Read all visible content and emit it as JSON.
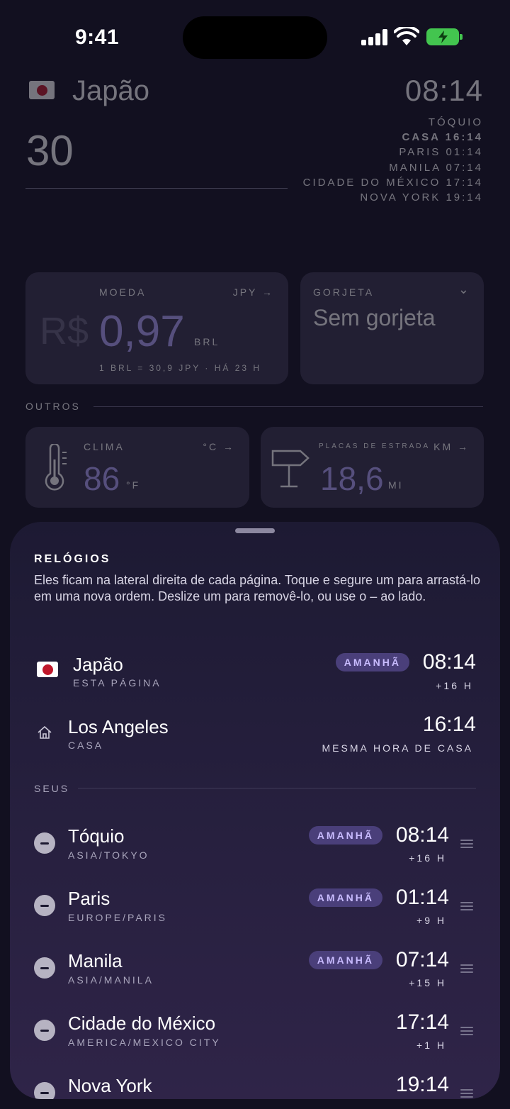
{
  "status_bar": {
    "time": "9:41"
  },
  "header": {
    "country": "Japão",
    "amount": "30",
    "main_clock": "08:14",
    "clocks": [
      {
        "text": "TÓQUIO"
      },
      {
        "text": "CASA 16:14"
      },
      {
        "text": "PARIS 01:14"
      },
      {
        "text": "MANILA 07:14"
      },
      {
        "text": "CIDADE DO MÉXICO 17:14"
      },
      {
        "text": "NOVA YORK 19:14"
      }
    ]
  },
  "currency_card": {
    "label": "MOEDA",
    "code": "JPY →",
    "symbol": "R$",
    "value": "0,97",
    "unit": "BRL",
    "footnote": "1 BRL = 30,9 JPY · HÁ 23 H"
  },
  "tip_card": {
    "label": "GORJETA",
    "chevron": "⌄",
    "value": "Sem gorjeta"
  },
  "others_section": {
    "label": "OUTROS"
  },
  "weather_card": {
    "label": "CLIMA",
    "unit_toggle": "°C →",
    "value": "86",
    "unit": "°F"
  },
  "roads_card": {
    "label": "PLACAS DE ESTRADA",
    "unit_toggle": "KM →",
    "value": "18,6",
    "unit": "MI"
  },
  "sheet": {
    "title": "RELÓGIOS",
    "description": "Eles ficam na lateral direita de cada página. Toque e segure um para arrastá-lo em uma nova ordem. Deslize um para removê-lo, ou use o – ao lado.",
    "current": {
      "name": "Japão",
      "sub": "ESTA PÁGINA",
      "badge": "AMANHÃ",
      "time": "08:14",
      "offset": "+16 H"
    },
    "home": {
      "name": "Los Angeles",
      "sub": "CASA",
      "time": "16:14",
      "offset": "MESMA HORA DE CASA"
    },
    "yours_label": "SEUS",
    "clocks": [
      {
        "name": "Tóquio",
        "tz": "ASIA/TOKYO",
        "badge": "AMANHÃ",
        "time": "08:14",
        "offset": "+16 H"
      },
      {
        "name": "Paris",
        "tz": "EUROPE/PARIS",
        "badge": "AMANHÃ",
        "time": "01:14",
        "offset": "+9 H"
      },
      {
        "name": "Manila",
        "tz": "ASIA/MANILA",
        "badge": "AMANHÃ",
        "time": "07:14",
        "offset": "+15 H"
      },
      {
        "name": "Cidade do México",
        "tz": "AMERICA/MEXICO CITY",
        "badge": "",
        "time": "17:14",
        "offset": "+1 H"
      },
      {
        "name": "Nova York",
        "tz": "",
        "badge": "",
        "time": "19:14",
        "offset": ""
      }
    ]
  }
}
